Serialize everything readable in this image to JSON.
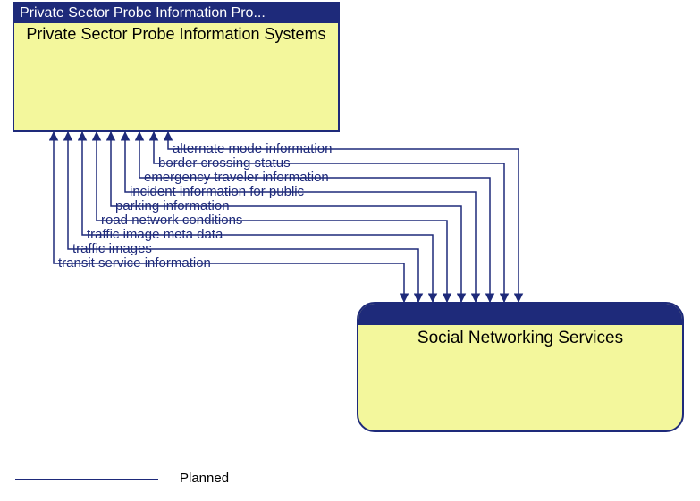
{
  "colors": {
    "border": "#1e2a7a",
    "fill": "#f3f79c",
    "headerBg": "#1e2a7a",
    "headerText": "#ffffff"
  },
  "topBox": {
    "header": "Private Sector Probe Information Pro...",
    "title": "Private Sector Probe Information Systems"
  },
  "bottomBox": {
    "header": "",
    "title": "Social Networking Services"
  },
  "flows": [
    {
      "label": "alternate mode information"
    },
    {
      "label": "border crossing status"
    },
    {
      "label": "emergency traveler information"
    },
    {
      "label": "incident information for public"
    },
    {
      "label": "parking information"
    },
    {
      "label": "road network conditions"
    },
    {
      "label": "traffic image meta data"
    },
    {
      "label": "traffic images"
    },
    {
      "label": "transit service information"
    }
  ],
  "legend": {
    "label": "Planned"
  }
}
